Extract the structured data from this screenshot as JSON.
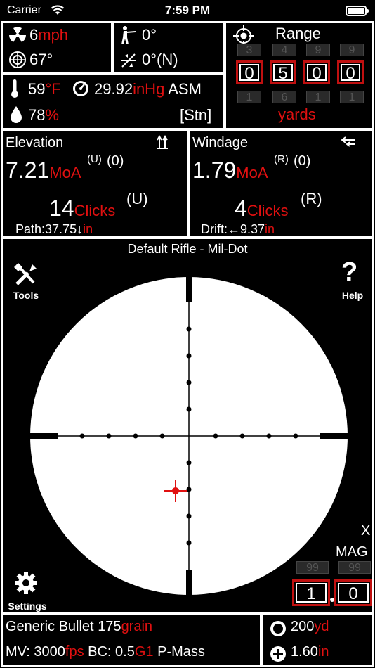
{
  "status_bar": {
    "carrier": "Carrier",
    "time": "7:59 PM"
  },
  "wind": {
    "speed": "6",
    "speed_unit": "mph",
    "direction": "67°"
  },
  "shooting_angle": {
    "incline": "0°",
    "cant": "0°(N)"
  },
  "range": {
    "title": "Range",
    "digits": [
      "0",
      "5",
      "0",
      "0"
    ],
    "above": [
      "3",
      "4",
      "9",
      "9"
    ],
    "below": [
      "1",
      "6",
      "1",
      "1"
    ],
    "unit": "yards"
  },
  "atmosphere": {
    "temp": "59",
    "temp_unit": "°F",
    "pressure": "29.92",
    "pressure_unit": "inHg",
    "pressure_mode": "ASM",
    "humidity": "78",
    "humidity_unit": "%",
    "station": "[Stn]"
  },
  "elevation": {
    "title": "Elevation",
    "value": "7.21",
    "unit": "MoA",
    "dir": "(U)",
    "paren": "(0)",
    "clicks": "14",
    "clicks_unit": "Clicks",
    "clicks_dir": "(U)",
    "path_label": "Path:",
    "path_value": "37.75↓",
    "path_unit": "in"
  },
  "windage": {
    "title": "Windage",
    "value": "1.79",
    "unit": "MoA",
    "dir": "(R)",
    "paren": "(0)",
    "clicks": "4",
    "clicks_unit": "Clicks",
    "clicks_dir": "(R)",
    "drift_label": "Drift:",
    "drift_value": "←9.37",
    "drift_unit": "in"
  },
  "scope": {
    "title": "Default Rifle - Mil-Dot",
    "tools_label": "Tools",
    "help_label": "Help",
    "settings_label": "Settings",
    "mag_x": "X",
    "mag_label": "MAG",
    "mag_digits": [
      "1",
      "0"
    ],
    "mag_above": [
      "99",
      "99"
    ]
  },
  "bullet": {
    "name": "Generic Bullet",
    "weight": "175",
    "weight_unit": "grain",
    "mv_label": "MV:",
    "mv_value": "3000",
    "mv_unit": "fps",
    "bc_label": "BC:",
    "bc_value": "0.5",
    "bc_model": "G1",
    "mass_label": "P-Mass"
  },
  "zero": {
    "range": "200",
    "range_unit": "yd",
    "height": "1.60",
    "height_unit": "in"
  },
  "colors": {
    "accent": "#e01010",
    "background": "#000000",
    "foreground": "#ffffff"
  }
}
